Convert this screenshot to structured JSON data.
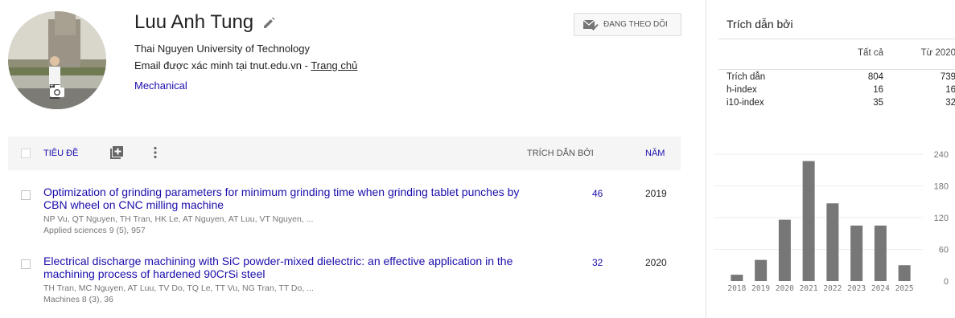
{
  "profile": {
    "name": "Luu Anh Tung",
    "affiliation": "Thai Nguyen University of Technology",
    "email_text": "Email được xác minh tại tnut.edu.vn - ",
    "homepage_link": "Trang chủ",
    "interest": "Mechanical",
    "follow_button": "ĐANG THEO DÕI"
  },
  "table": {
    "header_title": "TIÊU ĐỀ",
    "header_cited": "TRÍCH DẪN BỞI",
    "header_year": "NĂM",
    "articles": [
      {
        "title": "Optimization of grinding parameters for minimum grinding time when grinding tablet punches by CBN wheel on CNC milling machine",
        "authors": "NP Vu, QT Nguyen, TH Tran, HK Le, AT Nguyen, AT Luu, VT Nguyen, ...",
        "venue": "Applied sciences 9 (5), 957",
        "cited": "46",
        "year": "2019"
      },
      {
        "title": "Electrical discharge machining with SiC powder-mixed dielectric: an effective application in the machining process of hardened 90CrSi steel",
        "authors": "TH Tran, MC Nguyen, AT Luu, TV Do, TQ Le, TT Vu, NG Tran, TT Do, ...",
        "venue": "Machines 8 (3), 36",
        "cited": "32",
        "year": "2020"
      }
    ]
  },
  "citations": {
    "title": "Trích dẫn bởi",
    "col_all": "Tất cả",
    "col_since": "Từ 2020",
    "rows": [
      {
        "label": "Trích dẫn",
        "all": "804",
        "since": "739"
      },
      {
        "label": "h-index",
        "all": "16",
        "since": "16"
      },
      {
        "label": "i10-index",
        "all": "35",
        "since": "32"
      }
    ]
  },
  "chart_data": {
    "type": "bar",
    "categories": [
      "2018",
      "2019",
      "2020",
      "2021",
      "2022",
      "2023",
      "2024",
      "2025"
    ],
    "values": [
      12,
      40,
      116,
      227,
      147,
      105,
      105,
      30
    ],
    "yticks": [
      "0",
      "60",
      "120",
      "180",
      "240"
    ],
    "ylim": [
      0,
      240
    ],
    "grid": true,
    "bar_color": "#777777"
  },
  "colors": {
    "link": "#1a0dab",
    "header_bg": "#f5f5f5"
  }
}
